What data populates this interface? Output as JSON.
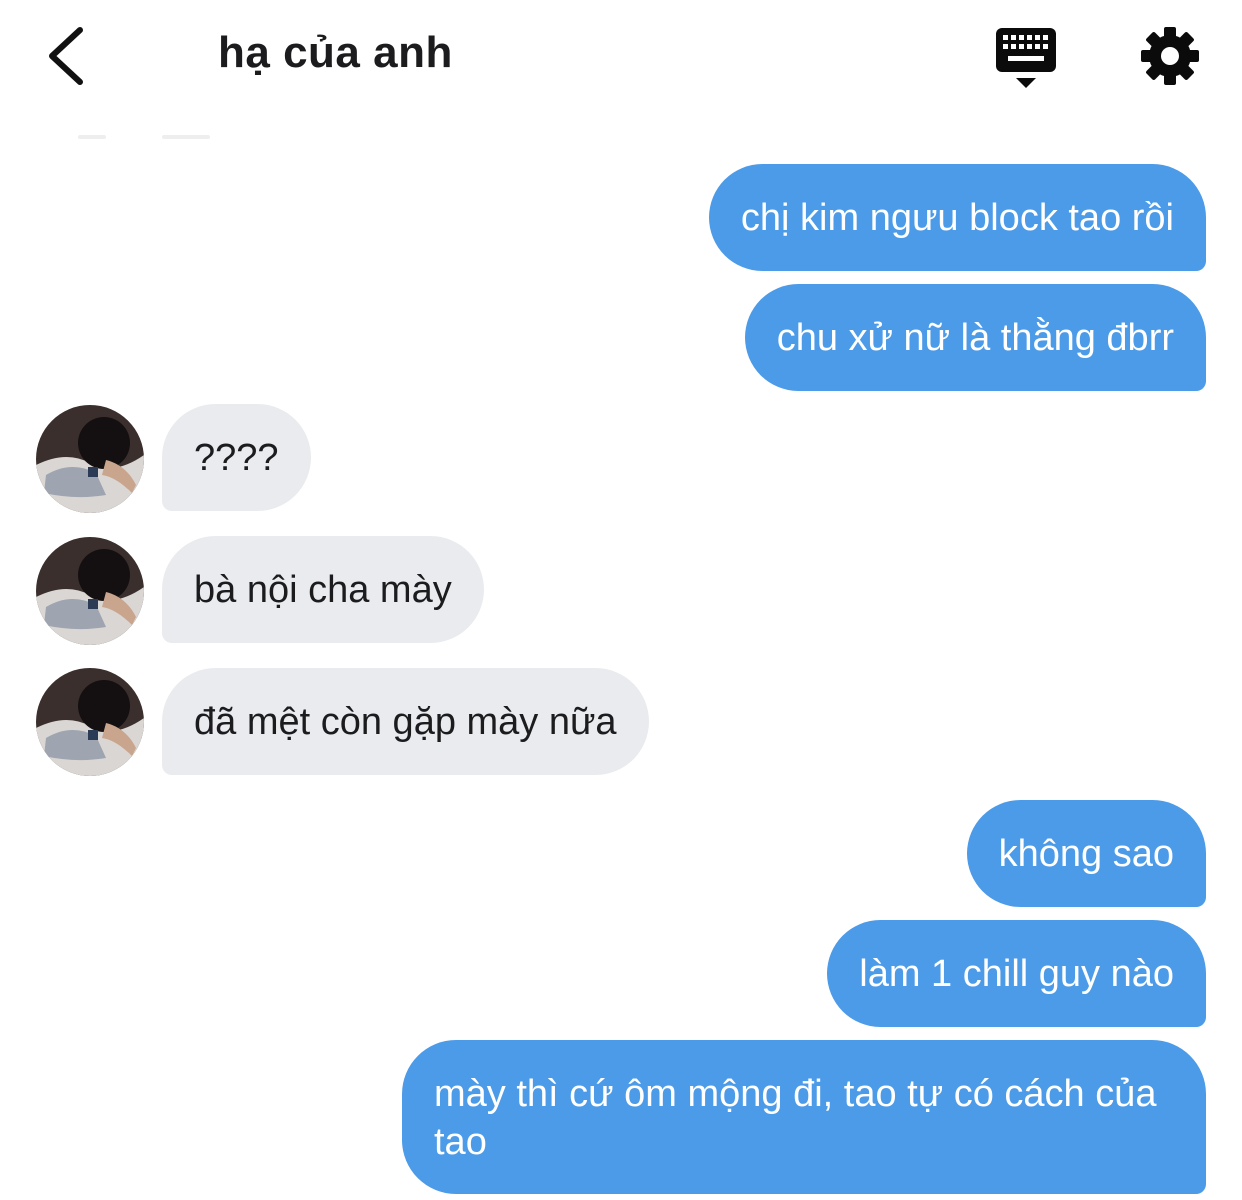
{
  "header": {
    "title": "hạ của anh",
    "back_icon": "chevron-left-icon",
    "keyboard_icon": "keyboard-icon",
    "settings_icon": "gear-icon"
  },
  "messages": [
    {
      "from": "me",
      "text": "chị kim ngưu block tao rồi"
    },
    {
      "from": "me",
      "text": "chu xử nữ là thằng đbrr"
    },
    {
      "from": "them",
      "text": "????"
    },
    {
      "from": "them",
      "text": "bà nội cha mày"
    },
    {
      "from": "them",
      "text": "đã mệt còn gặp mày nữa"
    },
    {
      "from": "me",
      "text": "không sao"
    },
    {
      "from": "me",
      "text": "làm 1 chill guy nào"
    },
    {
      "from": "me",
      "text": "mày thì cứ ôm mộng đi, tao tự có cách của tao"
    }
  ],
  "colors": {
    "outgoing_bubble": "#4c9be8",
    "incoming_bubble": "#e9ebee",
    "text_dark": "#1c1c1e"
  }
}
